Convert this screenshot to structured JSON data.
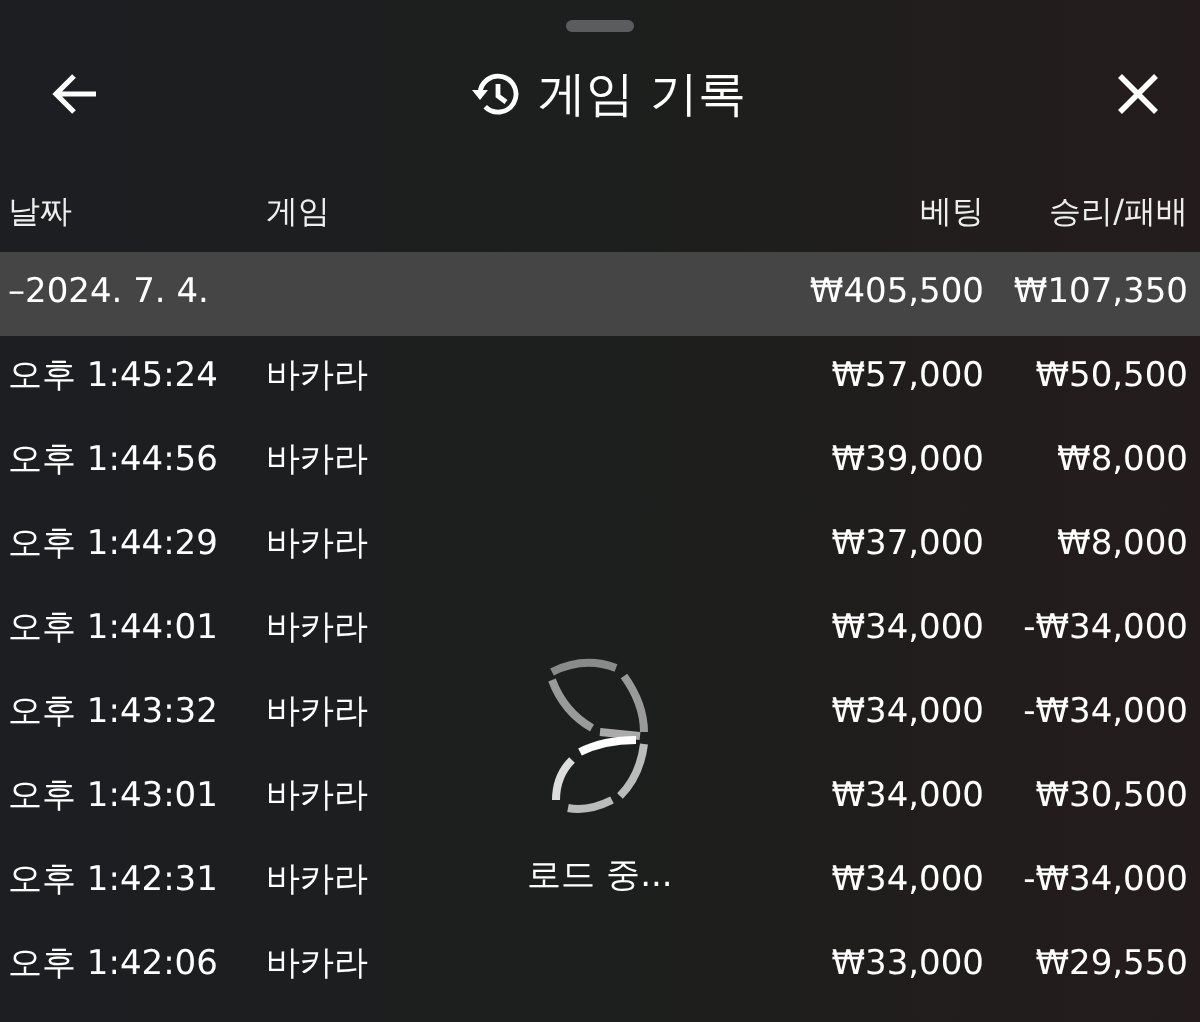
{
  "header": {
    "title": "게임 기록"
  },
  "table": {
    "columns": [
      "날짜",
      "게임",
      "베팅",
      "승리/패배"
    ],
    "group": {
      "toggle": "–",
      "date": "2024. 7. 4.",
      "bet": "₩405,500",
      "result": "₩107,350"
    },
    "rows": [
      {
        "time": "오후 1:45:24",
        "game": "바카라",
        "bet": "₩57,000",
        "result": "₩50,500"
      },
      {
        "time": "오후 1:44:56",
        "game": "바카라",
        "bet": "₩39,000",
        "result": "₩8,000"
      },
      {
        "time": "오후 1:44:29",
        "game": "바카라",
        "bet": "₩37,000",
        "result": "₩8,000"
      },
      {
        "time": "오후 1:44:01",
        "game": "바카라",
        "bet": "₩34,000",
        "result": "-₩34,000"
      },
      {
        "time": "오후 1:43:32",
        "game": "바카라",
        "bet": "₩34,000",
        "result": "-₩34,000"
      },
      {
        "time": "오후 1:43:01",
        "game": "바카라",
        "bet": "₩34,000",
        "result": "₩30,500"
      },
      {
        "time": "오후 1:42:31",
        "game": "바카라",
        "bet": "₩34,000",
        "result": "-₩34,000"
      },
      {
        "time": "오후 1:42:06",
        "game": "바카라",
        "bet": "₩33,000",
        "result": "₩29,550"
      }
    ]
  },
  "loading": {
    "text": "로드 중..."
  }
}
